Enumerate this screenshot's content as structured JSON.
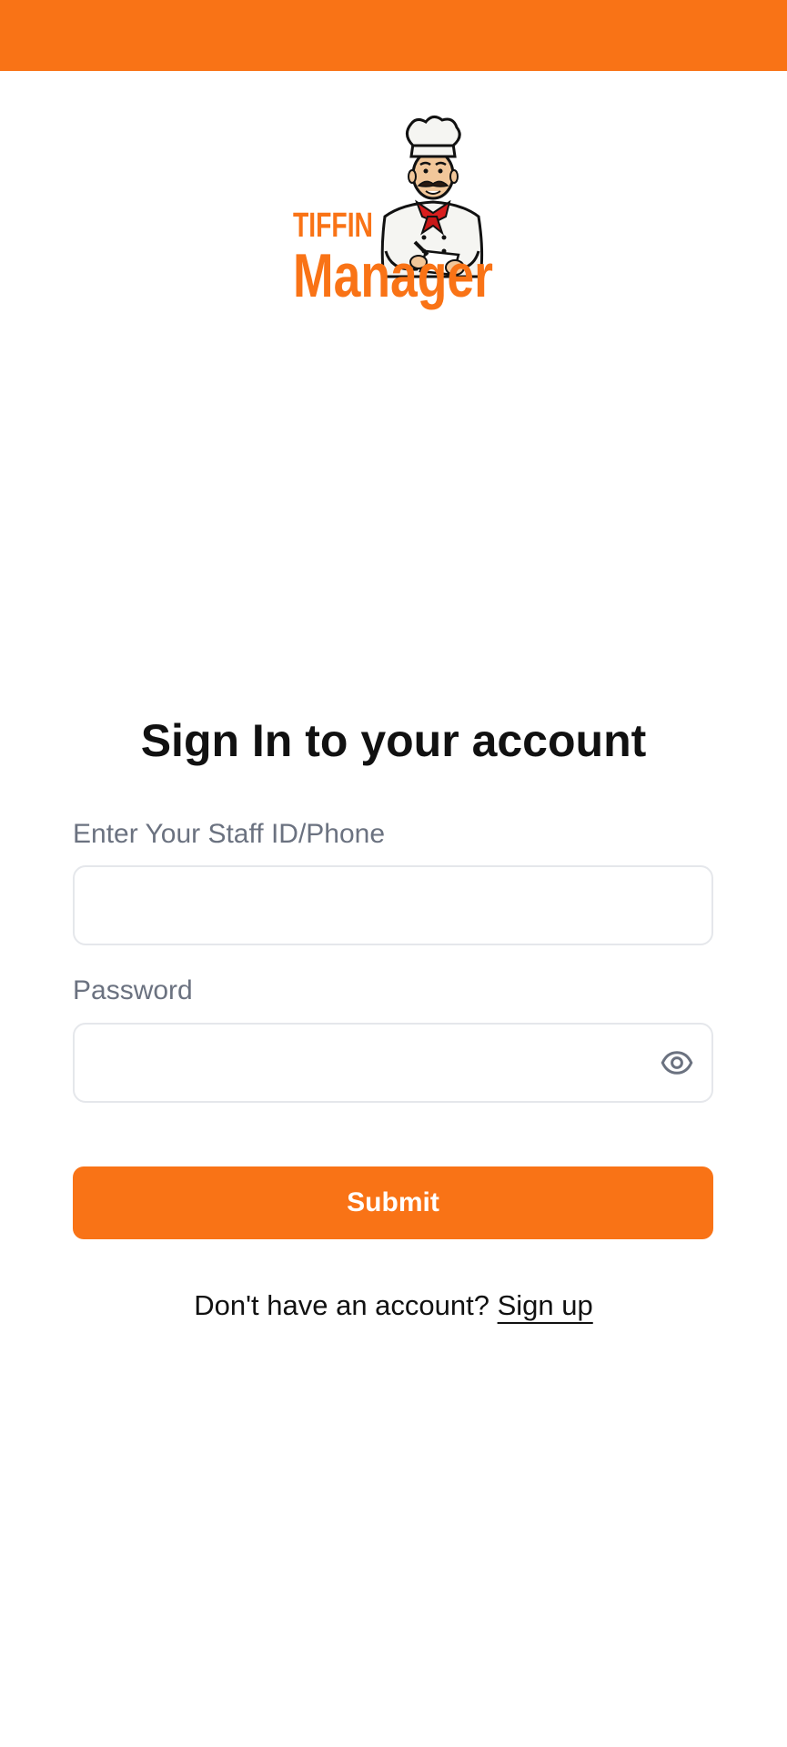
{
  "app": {
    "brand_top": "TIFFIN",
    "brand_main": "Manager",
    "brand_color": "#F97316",
    "header_color": "#F97316"
  },
  "form": {
    "title": "Sign In to your account",
    "staff_label": "Enter Your Staff ID/Phone",
    "staff_value": "",
    "staff_placeholder": "",
    "password_label": "Password",
    "password_value": "",
    "password_placeholder": "",
    "password_toggle_icon": "eye-icon",
    "submit_label": "Submit",
    "submit_color": "#F97316"
  },
  "footer": {
    "prompt": "Don't have an account?",
    "signup_label": "Sign up"
  }
}
